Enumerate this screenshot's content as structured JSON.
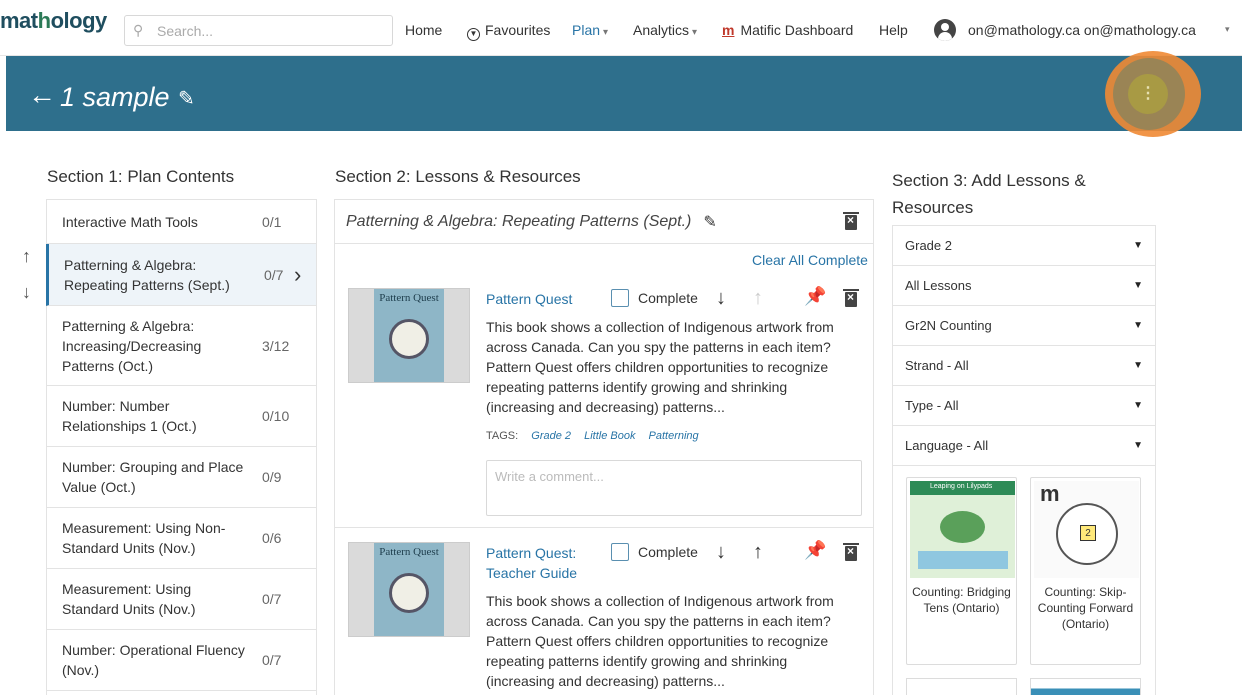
{
  "nav": {
    "logo": "mathology",
    "search_placeholder": "Search...",
    "home": "Home",
    "favourites": "Favourites",
    "plan": "Plan",
    "analytics": "Analytics",
    "matific": "Matific Dashboard",
    "help": "Help",
    "user": "on@mathology.ca on@mathology.ca"
  },
  "banner": {
    "title": "1 sample"
  },
  "section1": {
    "title": "Section 1: Plan Contents",
    "items": [
      {
        "label": "Interactive Math Tools",
        "count": "0/1"
      },
      {
        "label": "Patterning & Algebra: Repeating Patterns (Sept.)",
        "count": "0/7",
        "selected": true
      },
      {
        "label": "Patterning & Algebra: Increasing/Decreasing Patterns (Oct.)",
        "count": "3/12"
      },
      {
        "label": "Number: Number Relationships 1 (Oct.)",
        "count": "0/10"
      },
      {
        "label": "Number: Grouping and Place Value (Oct.)",
        "count": "0/9"
      },
      {
        "label": "Measurement: Using Non-Standard Units (Nov.)",
        "count": "0/6"
      },
      {
        "label": "Measurement: Using Standard Units (Nov.)",
        "count": "0/7"
      },
      {
        "label": "Number: Operational Fluency (Nov.)",
        "count": "0/7"
      }
    ]
  },
  "section2": {
    "title": "Section 2: Lessons & Resources",
    "unit_title": "Patterning & Algebra: Repeating Patterns (Sept.)",
    "clear_all": "Clear All Complete",
    "resources": [
      {
        "title": "Pattern Quest",
        "thumb_title": "Pattern Quest",
        "complete_label": "Complete",
        "description": "This book shows a collection of Indigenous artwork from across Canada. Can you spy the patterns in each item? Pattern Quest offers children opportunities to recognize repeating patterns identify growing and shrinking (increasing and decreasing) patterns...",
        "tags_label": "TAGS:",
        "tags": [
          "Grade 2",
          "Little Book",
          "Patterning"
        ],
        "comment_placeholder": "Write a comment..."
      },
      {
        "title": "Pattern Quest: Teacher Guide",
        "thumb_title": "Pattern Quest",
        "complete_label": "Complete",
        "description": "This book shows a collection of Indigenous artwork from across Canada. Can you spy the patterns in each item? Pattern Quest offers children opportunities to recognize repeating patterns identify growing and shrinking (increasing and decreasing) patterns..."
      }
    ]
  },
  "section3": {
    "title": "Section 3: Add Lessons & Resources",
    "filters": [
      "Grade 2",
      "All Lessons",
      "Gr2N Counting",
      "Strand - All",
      "Type - All",
      "Language - All"
    ],
    "cards": [
      {
        "caption": "Counting: Bridging Tens (Ontario)",
        "thumb_text": "Leaping on Lilypads"
      },
      {
        "caption": "Counting: Skip-Counting Forward (Ontario)",
        "thumb_text": "m"
      }
    ]
  },
  "icons": {
    "accent": "#2e6f8c",
    "link": "#2874a6",
    "highlight_ring": "#f08a34"
  }
}
